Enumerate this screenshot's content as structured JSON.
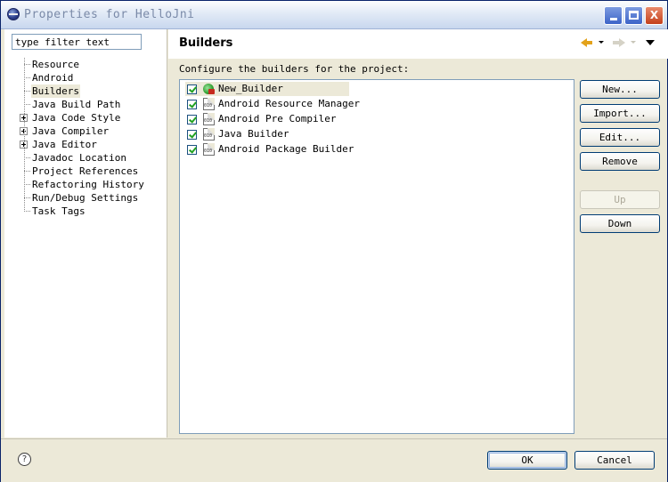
{
  "window": {
    "title": "Properties for HelloJni",
    "minimize_icon": "minimize-icon",
    "maximize_icon": "maximize-icon",
    "close_label": "X"
  },
  "sidebar": {
    "filter": {
      "value": "type filter text"
    },
    "items": [
      {
        "label": "Resource",
        "expandable": false,
        "selected": false
      },
      {
        "label": "Android",
        "expandable": false,
        "selected": false
      },
      {
        "label": "Builders",
        "expandable": false,
        "selected": true
      },
      {
        "label": "Java Build Path",
        "expandable": false,
        "selected": false
      },
      {
        "label": "Java Code Style",
        "expandable": true,
        "selected": false
      },
      {
        "label": "Java Compiler",
        "expandable": true,
        "selected": false
      },
      {
        "label": "Java Editor",
        "expandable": true,
        "selected": false
      },
      {
        "label": "Javadoc Location",
        "expandable": false,
        "selected": false
      },
      {
        "label": "Project References",
        "expandable": false,
        "selected": false
      },
      {
        "label": "Refactoring History",
        "expandable": false,
        "selected": false
      },
      {
        "label": "Run/Debug Settings",
        "expandable": false,
        "selected": false
      },
      {
        "label": "Task Tags",
        "expandable": false,
        "selected": false
      }
    ]
  },
  "main": {
    "title": "Builders",
    "description": "Configure the builders for the project:",
    "builders": [
      {
        "label": "New_Builder",
        "checked": true,
        "icon": "external-builder-icon",
        "selected": true
      },
      {
        "label": "Android Resource Manager",
        "checked": true,
        "icon": "binary-builder-icon",
        "selected": false
      },
      {
        "label": "Android Pre Compiler",
        "checked": true,
        "icon": "binary-builder-icon",
        "selected": false
      },
      {
        "label": "Java Builder",
        "checked": true,
        "icon": "binary-builder-icon",
        "selected": false
      },
      {
        "label": "Android Package Builder",
        "checked": true,
        "icon": "binary-builder-icon",
        "selected": false
      }
    ],
    "buttons": {
      "new": "New...",
      "import": "Import...",
      "edit": "Edit...",
      "remove": "Remove",
      "up": "Up",
      "down": "Down"
    }
  },
  "footer": {
    "help": "?",
    "ok": "OK",
    "cancel": "Cancel"
  },
  "colors": {
    "selection": "#ece9d8",
    "button_border": "#003c74",
    "dialog_bg": "#ece9d8"
  }
}
